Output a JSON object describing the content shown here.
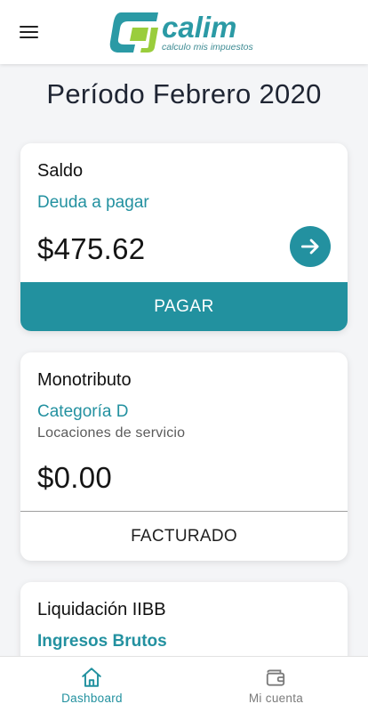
{
  "header": {
    "logo_text": "calim",
    "logo_tagline": "calculo mis impuestos"
  },
  "period": {
    "title": "Período Febrero 2020"
  },
  "cards": [
    {
      "title": "Saldo",
      "subtitle": "Deuda a pagar",
      "amount": "$475.62",
      "action_label": "PAGAR"
    },
    {
      "title": "Monotributo",
      "subtitle": "Categoría D",
      "description": "Locaciones de servicio",
      "amount": "$0.00",
      "action_label": "FACTURADO"
    },
    {
      "title": "Liquidación IIBB",
      "subtitle": "Ingresos Brutos"
    }
  ],
  "bottom_nav": [
    {
      "label": "Dashboard",
      "icon": "home-icon",
      "active": true
    },
    {
      "label": "Mi cuenta",
      "icon": "wallet-icon",
      "active": false
    }
  ],
  "colors": {
    "accent": "#22919f",
    "logo_green": "#9acd3c",
    "background": "#f4f5f7"
  }
}
